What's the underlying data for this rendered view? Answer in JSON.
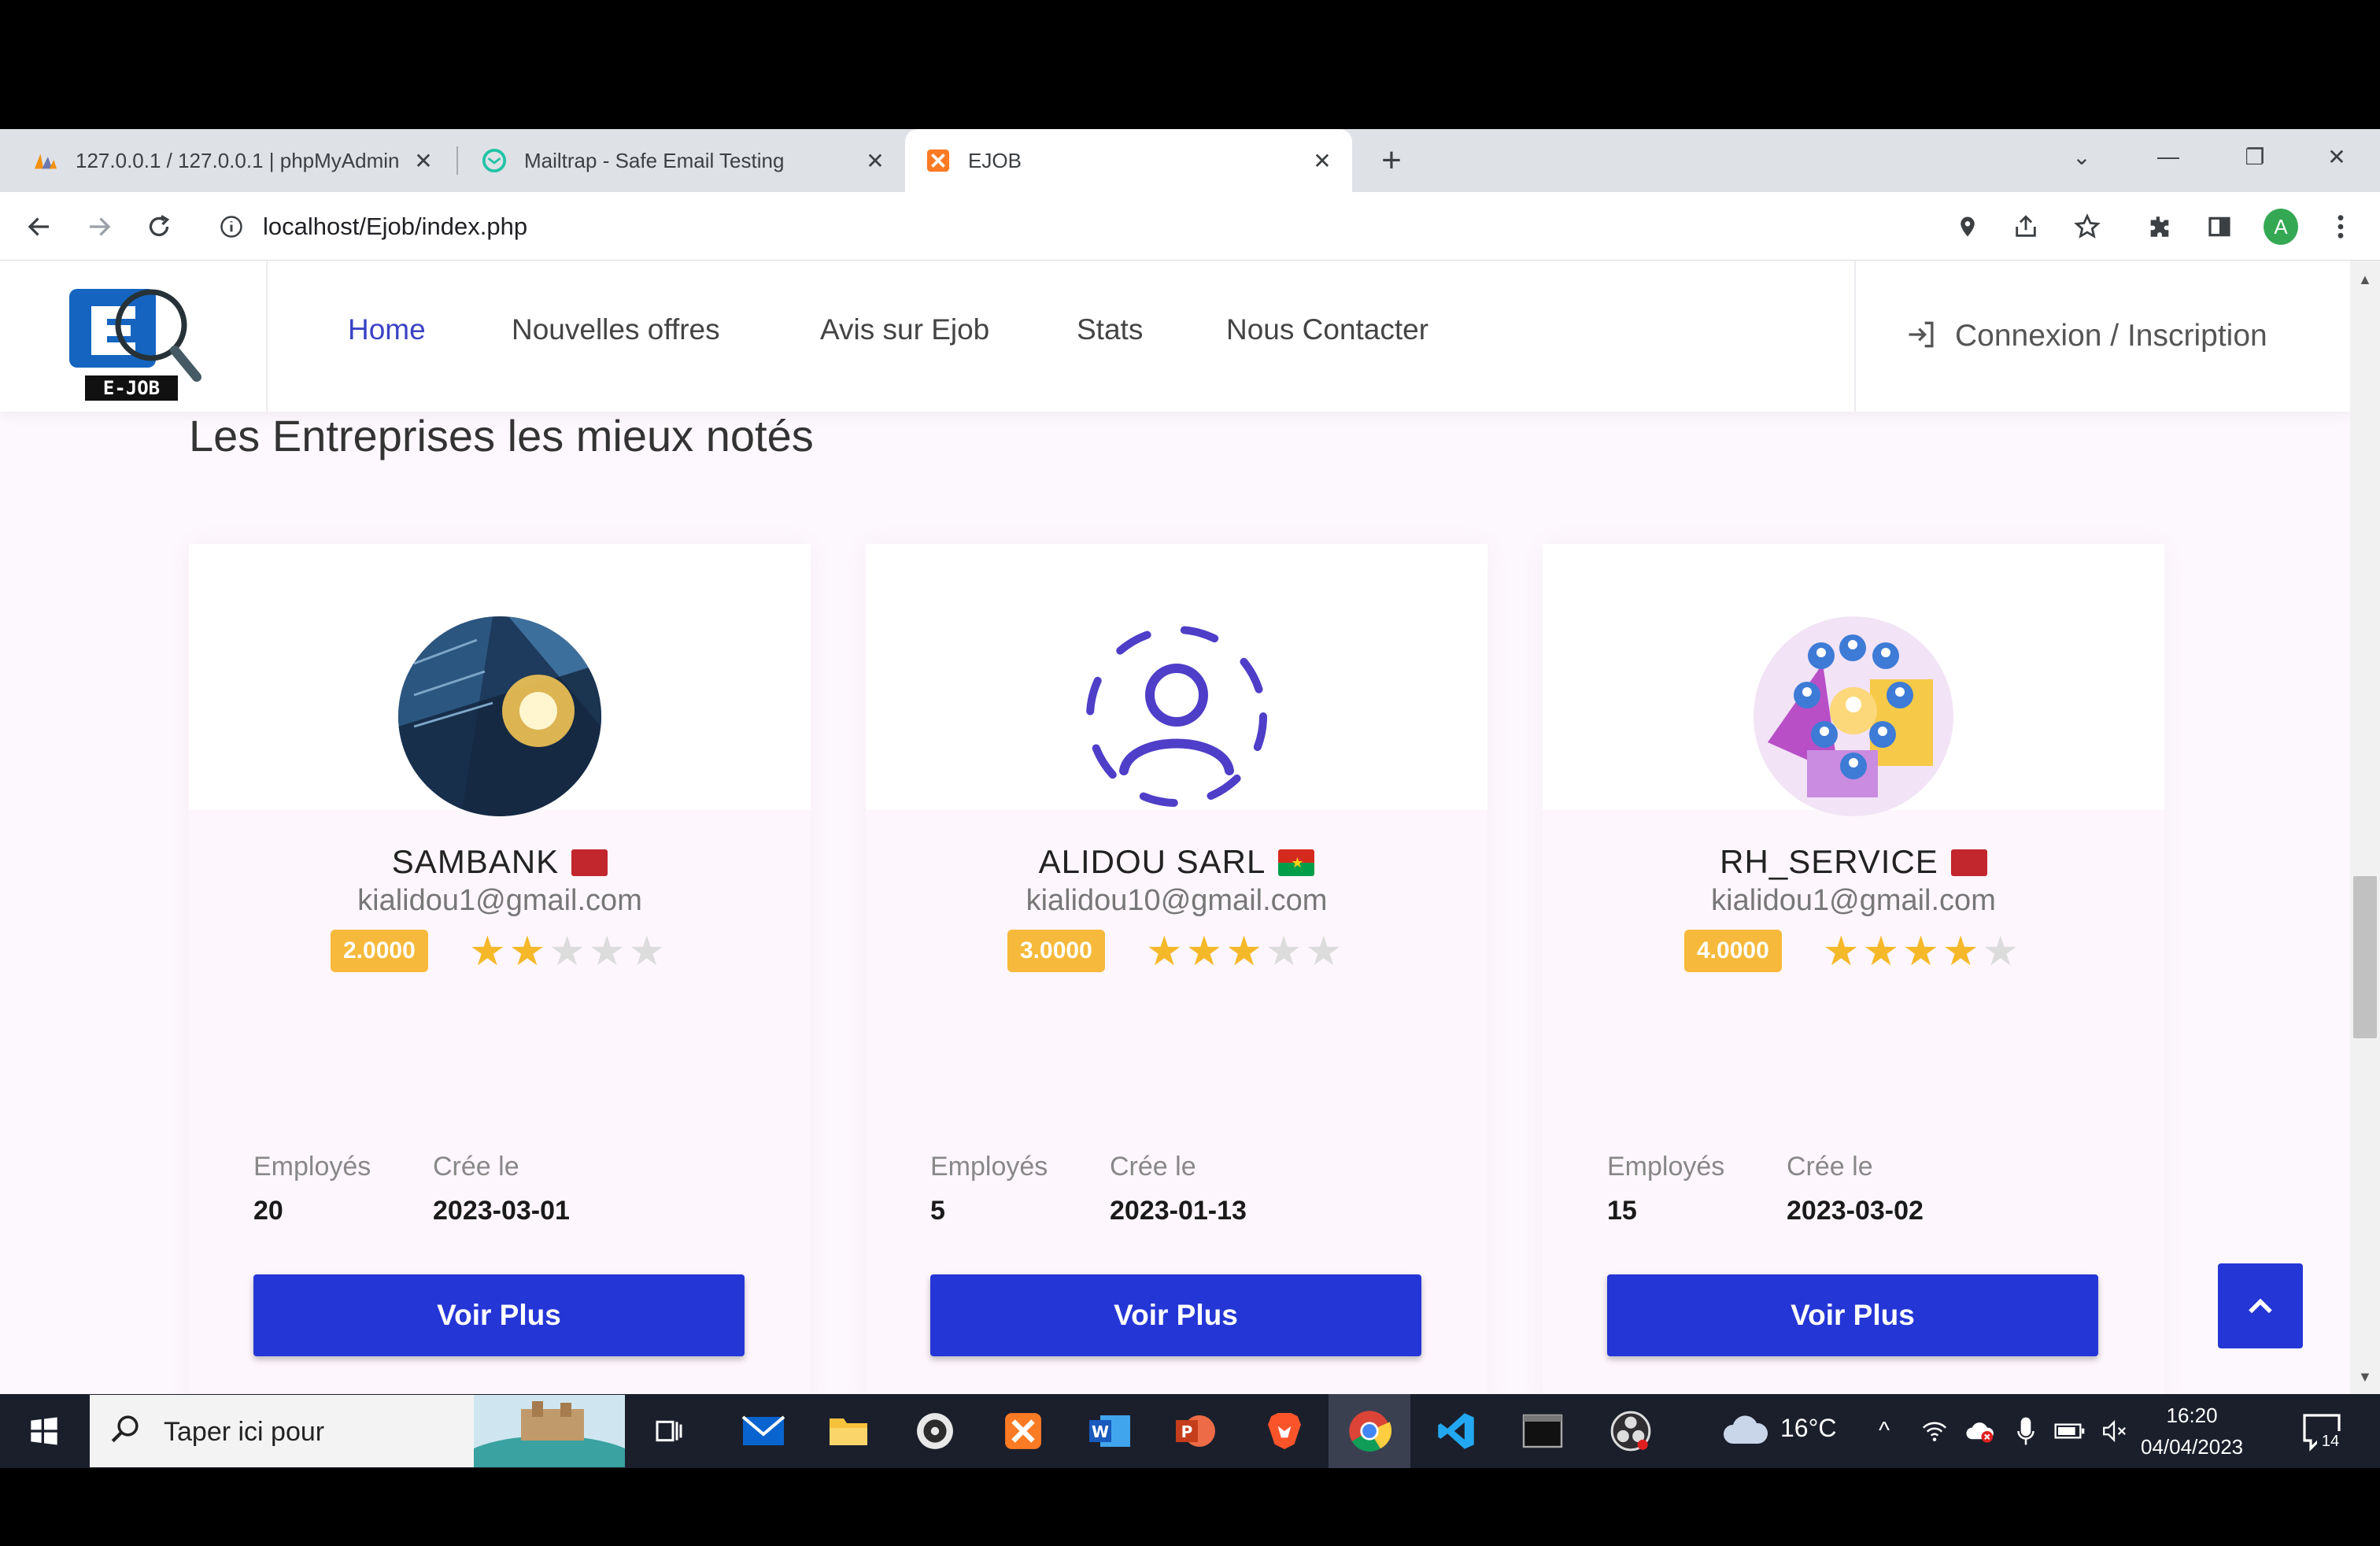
{
  "browser": {
    "tabs": [
      {
        "title": "127.0.0.1 / 127.0.0.1 | phpMyAdmin",
        "favicon": "phpmyadmin-icon"
      },
      {
        "title": "Mailtrap - Safe Email Testing",
        "favicon": "mailtrap-icon"
      },
      {
        "title": "EJOB",
        "favicon": "xampp-icon"
      }
    ],
    "url": "localhost/Ejob/index.php",
    "profile_initial": "A"
  },
  "site": {
    "logo_text": "E-JOB",
    "nav": [
      {
        "label": "Home",
        "active": true
      },
      {
        "label": "Nouvelles offres"
      },
      {
        "label": "Avis sur Ejob"
      },
      {
        "label": "Stats"
      },
      {
        "label": "Nous Contacter"
      }
    ],
    "login_label": "Connexion / Inscription",
    "section_title": "Les Entreprises les mieux notés"
  },
  "companies": [
    {
      "name": "SAMBANK",
      "email": "kialidou1@gmail.com",
      "rating": "2.0000",
      "stars": 2,
      "employees_label": "Employés",
      "employees": "20",
      "created_label": "Crée le",
      "created": "2023-03-01",
      "button": "Voir Plus",
      "flag": "morocco"
    },
    {
      "name": "ALIDOU SARL",
      "email": "kialidou10@gmail.com",
      "rating": "3.0000",
      "stars": 3,
      "employees_label": "Employés",
      "employees": "5",
      "created_label": "Crée le",
      "created": "2023-01-13",
      "button": "Voir Plus",
      "flag": "burkina-faso"
    },
    {
      "name": "RH_SERVICE",
      "email": "kialidou1@gmail.com",
      "rating": "4.0000",
      "stars": 4,
      "employees_label": "Employés",
      "employees": "15",
      "created_label": "Crée le",
      "created": "2023-03-02",
      "button": "Voir Plus",
      "flag": "morocco"
    }
  ],
  "taskbar": {
    "search_placeholder": "Taper ici pour",
    "weather": "16°C",
    "time": "16:20",
    "date": "04/04/2023",
    "notifications": "14"
  },
  "colors": {
    "accent": "#2536d6",
    "badge": "#f6b93b",
    "star": "#f5b829"
  }
}
